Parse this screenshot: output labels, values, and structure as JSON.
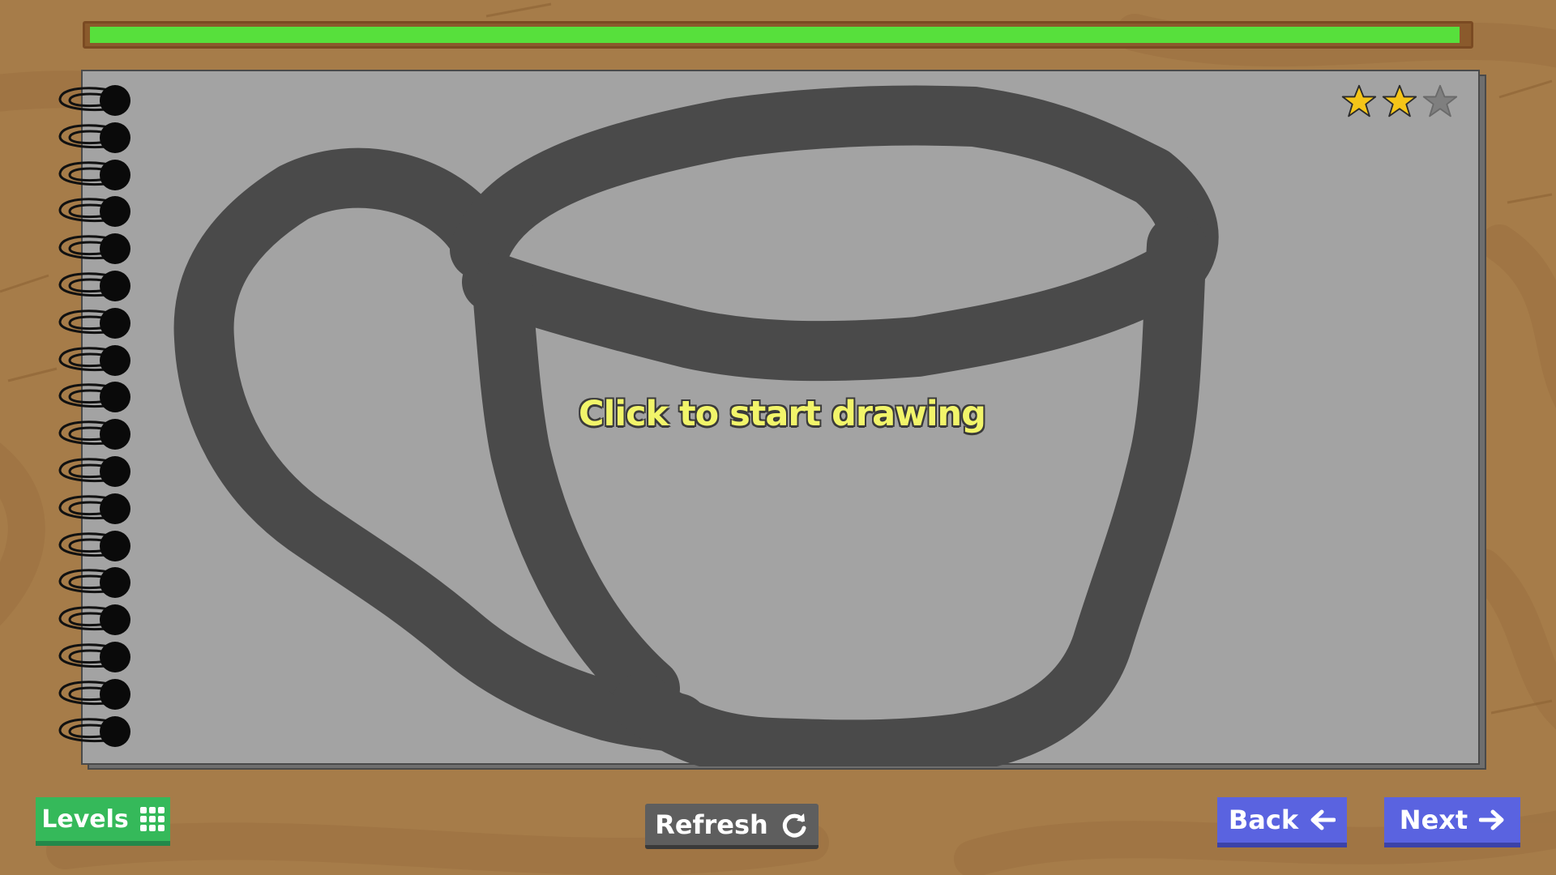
{
  "level_progress": {
    "fraction": 0.995,
    "fill_color": "#57e03c"
  },
  "rating": {
    "stars_earned": 2,
    "stars_total": 3,
    "earned_color": "#f5c518",
    "empty_color": "#7f7f7f"
  },
  "canvas": {
    "prompt": "Click to start drawing",
    "page_color": "#a3a3a3",
    "outline_color": "#4a4a4a",
    "subject": "teacup"
  },
  "buttons": {
    "levels": {
      "label": "Levels",
      "icon": "grid-icon",
      "color": "#35b95a"
    },
    "refresh": {
      "label": "Refresh",
      "icon": "refresh-icon",
      "color": "#5e5e5e"
    },
    "back": {
      "label": "Back",
      "icon": "arrow-left-icon",
      "color": "#5a63e0"
    },
    "next": {
      "label": "Next",
      "icon": "arrow-right-icon",
      "color": "#5a63e0"
    }
  },
  "background_color": "#a67c49"
}
